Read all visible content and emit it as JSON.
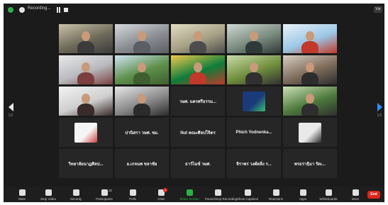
{
  "topbar": {
    "recording_label": "Recording...",
    "view_label": "Vie"
  },
  "nav": {
    "prev_page": "1/2",
    "next_page": "1/2"
  },
  "tiles": [
    {
      "type": "video",
      "active": true,
      "colors": [
        "#6e6a5a",
        "#c9c3a8",
        "#3b3b3b"
      ]
    },
    {
      "type": "video",
      "colors": [
        "#8a8e93",
        "#d6d8dc",
        "#5b5f64"
      ]
    },
    {
      "type": "video",
      "colors": [
        "#a6a085",
        "#e0dcc2",
        "#4c4c4c"
      ]
    },
    {
      "type": "video",
      "colors": [
        "#7a8b7f",
        "#cfd9d3",
        "#2f3a38"
      ]
    },
    {
      "type": "video",
      "colors": [
        "#9bc7e6",
        "#eaf2f8",
        "#c0392b"
      ]
    },
    {
      "type": "video",
      "colors": [
        "#b7b9bd",
        "#e9eaeb",
        "#7b3f3f"
      ]
    },
    {
      "type": "video",
      "colors": [
        "#5d8f4a",
        "#cfe4f3",
        "#3e5f2f"
      ]
    },
    {
      "type": "video",
      "colors": [
        "#0d7d3a",
        "#f2c94c",
        "#c0392b"
      ]
    },
    {
      "type": "video",
      "colors": [
        "#6f8e3c",
        "#c9dba9",
        "#303030"
      ]
    },
    {
      "type": "video",
      "colors": [
        "#7d6b5a",
        "#d8cfc4",
        "#2d2d2d"
      ]
    },
    {
      "type": "video",
      "colors": [
        "#cfcfcf",
        "#f3f3f3",
        "#3a2b2b"
      ]
    },
    {
      "type": "video",
      "colors": [
        "#8a8a8a",
        "#e7e7e7",
        "#2b2b2b"
      ]
    },
    {
      "type": "name",
      "name": "วษศ. นครศรีธรรม..."
    },
    {
      "type": "thumb",
      "thumb": [
        "#1a3a7a",
        "#38c172"
      ]
    },
    {
      "type": "video",
      "colors": [
        "#4e7a3d",
        "#cbe0b6",
        "#2e2e2e"
      ]
    },
    {
      "type": "thumb",
      "thumb": [
        "#f5f5f5",
        "#d04040"
      ]
    },
    {
      "type": "name",
      "name": "ปานิสรา วษศ. ชม."
    },
    {
      "type": "name",
      "name": "Nut คณะศิลปโจิตร"
    },
    {
      "type": "name",
      "name": "Phich  Yodnenka..."
    },
    {
      "type": "thumb",
      "thumb": [
        "#e9e9e9",
        "#2b2b2b"
      ]
    },
    {
      "type": "name",
      "name": "วิทยาลัยนาฏศิลป..."
    },
    {
      "type": "name",
      "name": "อ.เกจนพ ชลาชัย"
    },
    {
      "type": "name",
      "name": "ธาวัไมซ์ วษศ."
    },
    {
      "type": "name",
      "name": "จิราพร วงศ์ตลิ่ง ร..."
    },
    {
      "type": "name",
      "name": "พรธราธฺิมา รัตเ..."
    }
  ],
  "toolbar": {
    "items": [
      {
        "label": "Mute",
        "icon": "microphone-icon"
      },
      {
        "label": "Stop Video",
        "icon": "video-camera-icon"
      },
      {
        "label": "Security",
        "icon": "shield-icon"
      },
      {
        "label": "Participants",
        "icon": "participants-icon",
        "count": "32"
      },
      {
        "label": "Polls",
        "icon": "polls-icon"
      },
      {
        "label": "Chat",
        "icon": "chat-icon",
        "badge": "1"
      },
      {
        "label": "Share Screen",
        "icon": "share-screen-icon"
      },
      {
        "label": "Pause/Stop Recording",
        "icon": "pause-stop-icon"
      },
      {
        "label": "Show Captions",
        "icon": "captions-icon"
      },
      {
        "label": "Reactions",
        "icon": "reactions-icon"
      },
      {
        "label": "Apps",
        "icon": "apps-icon"
      },
      {
        "label": "Whiteboards",
        "icon": "whiteboard-icon"
      },
      {
        "label": "More",
        "icon": "more-icon"
      }
    ],
    "end_label": "End"
  },
  "colors": {
    "accent_green": "#27b345",
    "end_red": "#e0251b",
    "active_speaker": "#c9b33a",
    "nav_blue": "#2e8fff"
  }
}
